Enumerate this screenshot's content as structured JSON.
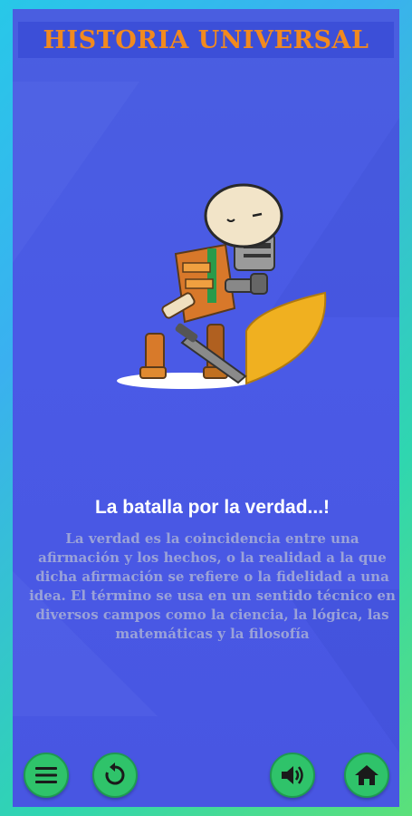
{
  "app": {
    "title": "HISTORIA UNIVERSAL"
  },
  "lesson": {
    "heading": "La batalla por la verdad...!",
    "body": "La verdad es la coincidencia entre una afirmación y los hechos, o la realidad a la que dicha afirmación se refiere o la fidelidad a una idea.  El término se usa en un sentido técnico en diversos campos como la ciencia, la lógica, las matemáticas y la filosofía"
  },
  "controls": {
    "menu_icon": "menu-icon",
    "restart_icon": "restart-icon",
    "sound_icon": "speaker-icon",
    "home_icon": "home-icon"
  },
  "colors": {
    "panel": "#4a5ae6",
    "title": "#f28a1e",
    "button": "#2fc36a",
    "body_text": "#9aa2d8"
  }
}
